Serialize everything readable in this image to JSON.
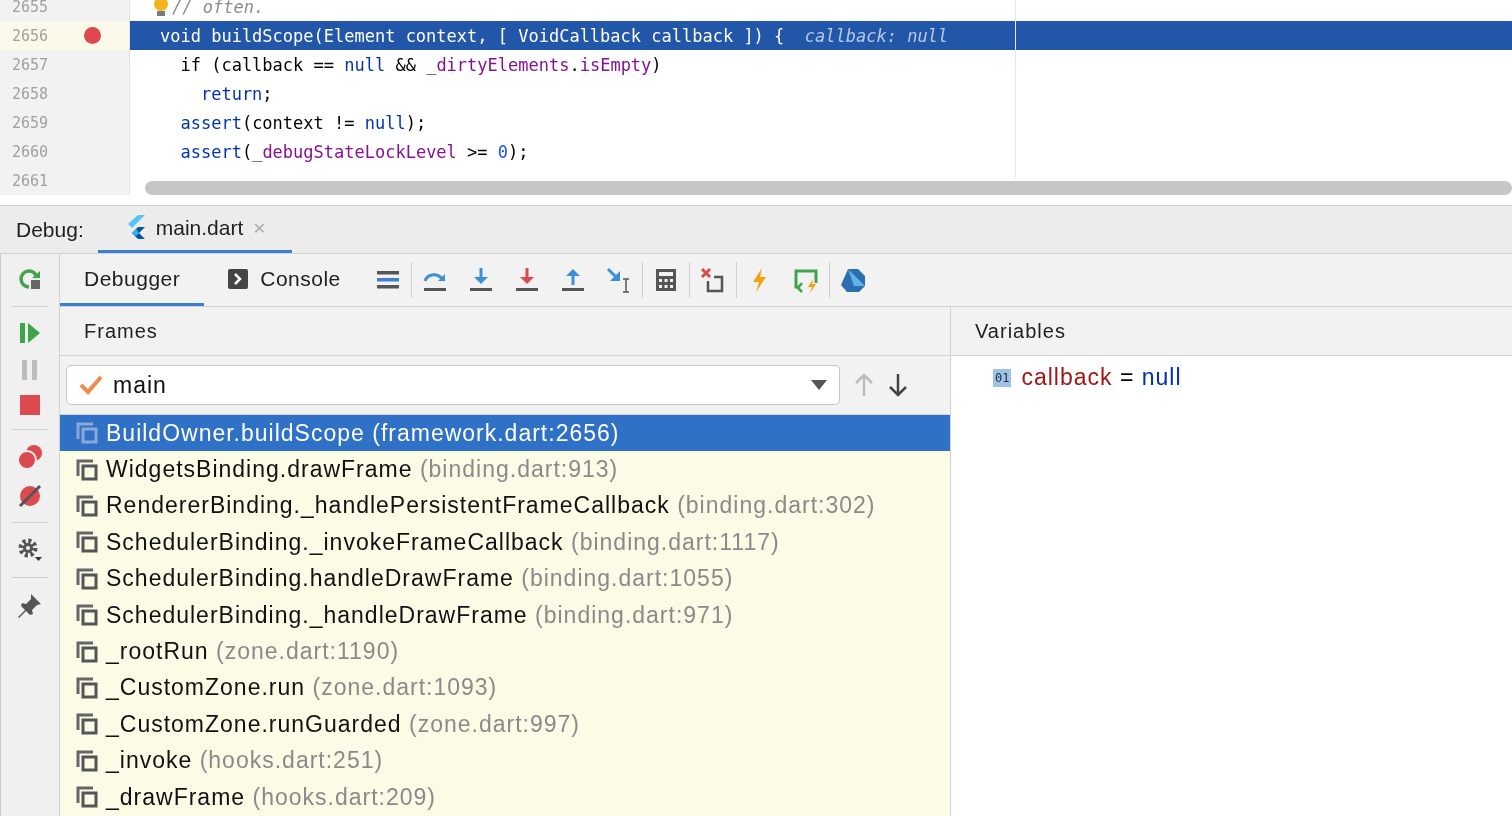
{
  "editor": {
    "lines": [
      {
        "number": "2655",
        "breakpoint": false,
        "current": false,
        "tokens": [
          {
            "kind": "comment",
            "text": "// often."
          }
        ],
        "bulb": true
      },
      {
        "number": "2656",
        "breakpoint": true,
        "current": true,
        "tokens": [
          {
            "kind": "plain",
            "text": "void buildScope(Element context, [ VoidCallback callback ]) { "
          },
          {
            "kind": "hint",
            "text": " callback: null"
          }
        ],
        "bulb": false
      },
      {
        "number": "2657",
        "breakpoint": false,
        "current": false,
        "tokens": [
          {
            "kind": "plain",
            "text": "  if (callback == "
          },
          {
            "kind": "keyword",
            "text": "null"
          },
          {
            "kind": "plain",
            "text": " && "
          },
          {
            "kind": "field",
            "text": "_dirtyElements"
          },
          {
            "kind": "plain",
            "text": "."
          },
          {
            "kind": "field",
            "text": "isEmpty"
          },
          {
            "kind": "plain",
            "text": ")"
          }
        ],
        "bulb": false
      },
      {
        "number": "2658",
        "breakpoint": false,
        "current": false,
        "tokens": [
          {
            "kind": "keyword",
            "text": "    return"
          },
          {
            "kind": "plain",
            "text": ";"
          }
        ],
        "bulb": false
      },
      {
        "number": "2659",
        "breakpoint": false,
        "current": false,
        "tokens": [
          {
            "kind": "keyword",
            "text": "  assert"
          },
          {
            "kind": "plain",
            "text": "(context != "
          },
          {
            "kind": "keyword",
            "text": "null"
          },
          {
            "kind": "plain",
            "text": ");"
          }
        ],
        "bulb": false
      },
      {
        "number": "2660",
        "breakpoint": false,
        "current": false,
        "tokens": [
          {
            "kind": "keyword",
            "text": "  assert"
          },
          {
            "kind": "plain",
            "text": "("
          },
          {
            "kind": "field",
            "text": "_debugStateLockLevel"
          },
          {
            "kind": "plain",
            "text": " >= "
          },
          {
            "kind": "number",
            "text": "0"
          },
          {
            "kind": "plain",
            "text": ");"
          }
        ],
        "bulb": false
      },
      {
        "number": "2661",
        "breakpoint": false,
        "current": false,
        "bulb": false
      }
    ]
  },
  "debug": {
    "label": "Debug:",
    "tab": "main.dart",
    "close": "×"
  },
  "toolbar": {
    "tabs": [
      {
        "label": "Debugger",
        "selected": true
      },
      {
        "label": "Console",
        "selected": false
      }
    ]
  },
  "frames": {
    "title": "Frames",
    "thread": "main",
    "items": [
      {
        "name": "BuildOwner.buildScope",
        "location": "(framework.dart:2656)",
        "selected": true
      },
      {
        "name": "WidgetsBinding.drawFrame",
        "location": "(binding.dart:913)",
        "selected": false
      },
      {
        "name": "RendererBinding._handlePersistentFrameCallback",
        "location": "(binding.dart:302)",
        "selected": false
      },
      {
        "name": "SchedulerBinding._invokeFrameCallback",
        "location": "(binding.dart:1117)",
        "selected": false
      },
      {
        "name": "SchedulerBinding.handleDrawFrame",
        "location": "(binding.dart:1055)",
        "selected": false
      },
      {
        "name": "SchedulerBinding._handleDrawFrame",
        "location": "(binding.dart:971)",
        "selected": false
      },
      {
        "name": "_rootRun",
        "location": "(zone.dart:1190)",
        "selected": false
      },
      {
        "name": "_CustomZone.run",
        "location": "(zone.dart:1093)",
        "selected": false
      },
      {
        "name": "_CustomZone.runGuarded",
        "location": "(zone.dart:997)",
        "selected": false
      },
      {
        "name": "_invoke",
        "location": "(hooks.dart:251)",
        "selected": false
      },
      {
        "name": "_drawFrame",
        "location": "(hooks.dart:209)",
        "selected": false
      }
    ]
  },
  "variables": {
    "title": "Variables",
    "items": [
      {
        "badge": "01",
        "name": "callback",
        "equals": "=",
        "value": "null"
      }
    ]
  }
}
